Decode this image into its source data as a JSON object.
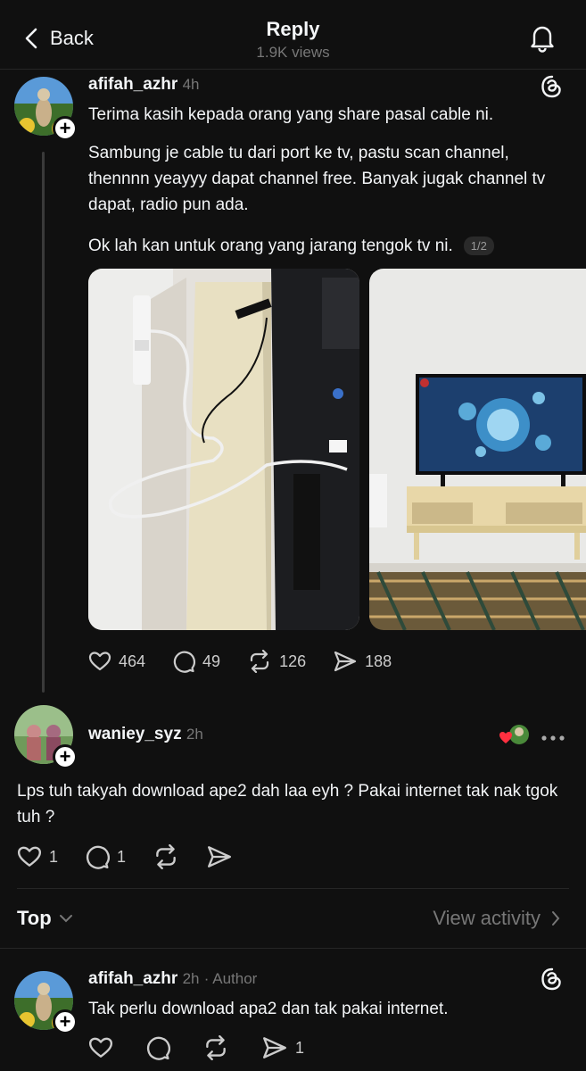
{
  "header": {
    "back_label": "Back",
    "title": "Reply",
    "views": "1.9K views"
  },
  "post": {
    "username": "afifah_azhr",
    "time": "4h",
    "paragraphs": [
      "Terima kasih kepada orang yang share pasal cable ni.",
      "Sambung je cable tu dari port ke tv, pastu scan channel, thennnn yeayyy dapat channel free. Banyak jugak channel tv dapat, radio pun ada.",
      "Ok lah kan untuk orang yang jarang tengok tv ni."
    ],
    "image_counter": "1/2",
    "likes": "464",
    "comments": "49",
    "reposts": "126",
    "shares": "188"
  },
  "reply": {
    "username": "waniey_syz",
    "time": "2h",
    "text": "Lps tuh takyah download ape2 dah laa eyh ? Pakai internet tak nak tgok tuh ?",
    "likes": "1",
    "comments": "1"
  },
  "sort": {
    "label": "Top",
    "view_activity": "View activity"
  },
  "author_reply": {
    "username": "afifah_azhr",
    "time": "2h",
    "author_tag": "· Author",
    "text": "Tak perlu download apa2 dan tak pakai internet.",
    "shares": "1"
  },
  "colors": {
    "background": "#101010",
    "text": "#f3f5f7",
    "muted": "#777777",
    "heart": "#ff3040"
  }
}
